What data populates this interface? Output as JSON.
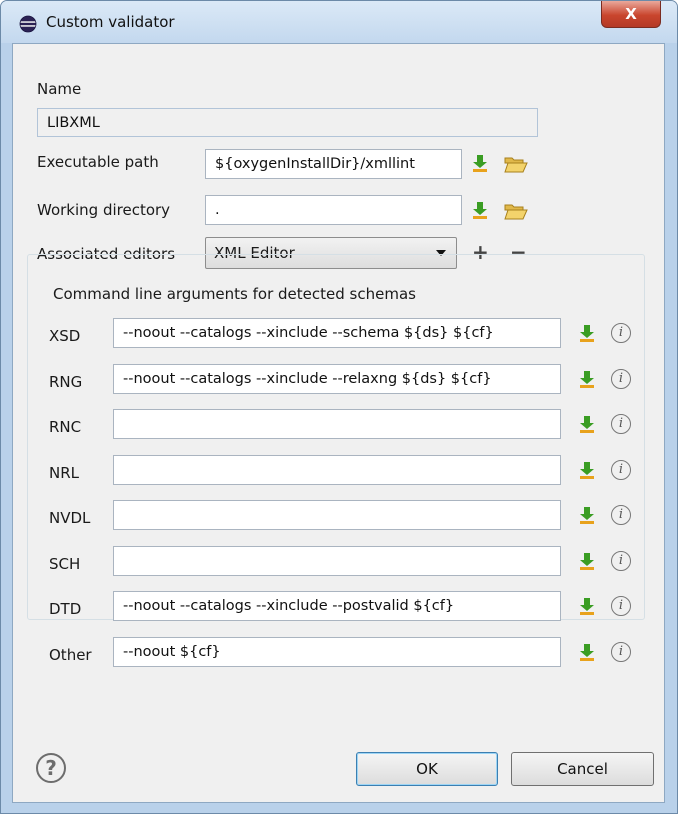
{
  "window": {
    "title": "Custom validator",
    "close_glyph": "X"
  },
  "form": {
    "name_label": "Name",
    "name_value": "LIBXML",
    "exec_label": "Executable path",
    "exec_value": "${oxygenInstallDir}/xmllint",
    "workdir_label": "Working directory",
    "workdir_value": ".",
    "editors_label": "Associated editors",
    "editors_selected": "XML Editor",
    "add_glyph": "+",
    "remove_glyph": "−"
  },
  "schemas": {
    "group_title": "Command line arguments for detected schemas",
    "rows": [
      {
        "label": "XSD",
        "value": "--noout --catalogs --xinclude --schema ${ds} ${cf}"
      },
      {
        "label": "RNG",
        "value": "--noout --catalogs --xinclude --relaxng ${ds} ${cf}"
      },
      {
        "label": "RNC",
        "value": ""
      },
      {
        "label": "NRL",
        "value": ""
      },
      {
        "label": "NVDL",
        "value": ""
      },
      {
        "label": "SCH",
        "value": ""
      },
      {
        "label": "DTD",
        "value": "--noout --catalogs --xinclude --postvalid ${cf}"
      },
      {
        "label": "Other",
        "value": "--noout ${cf}"
      }
    ],
    "info_glyph": "i"
  },
  "footer": {
    "help_glyph": "?",
    "ok_label": "OK",
    "cancel_label": "Cancel"
  },
  "icons": {
    "app": "eclipse-app-icon",
    "download": "download-arrow-icon",
    "folder": "open-folder-icon",
    "info": "info-icon",
    "help": "help-icon"
  },
  "colors": {
    "titlebar": "#c3d8ee",
    "close_button": "#c9452d",
    "dialog_bg": "#f0f0f0",
    "download_green": "#3a9d23",
    "download_base": "#e8a21c",
    "folder_yellow": "#f3d36b"
  }
}
